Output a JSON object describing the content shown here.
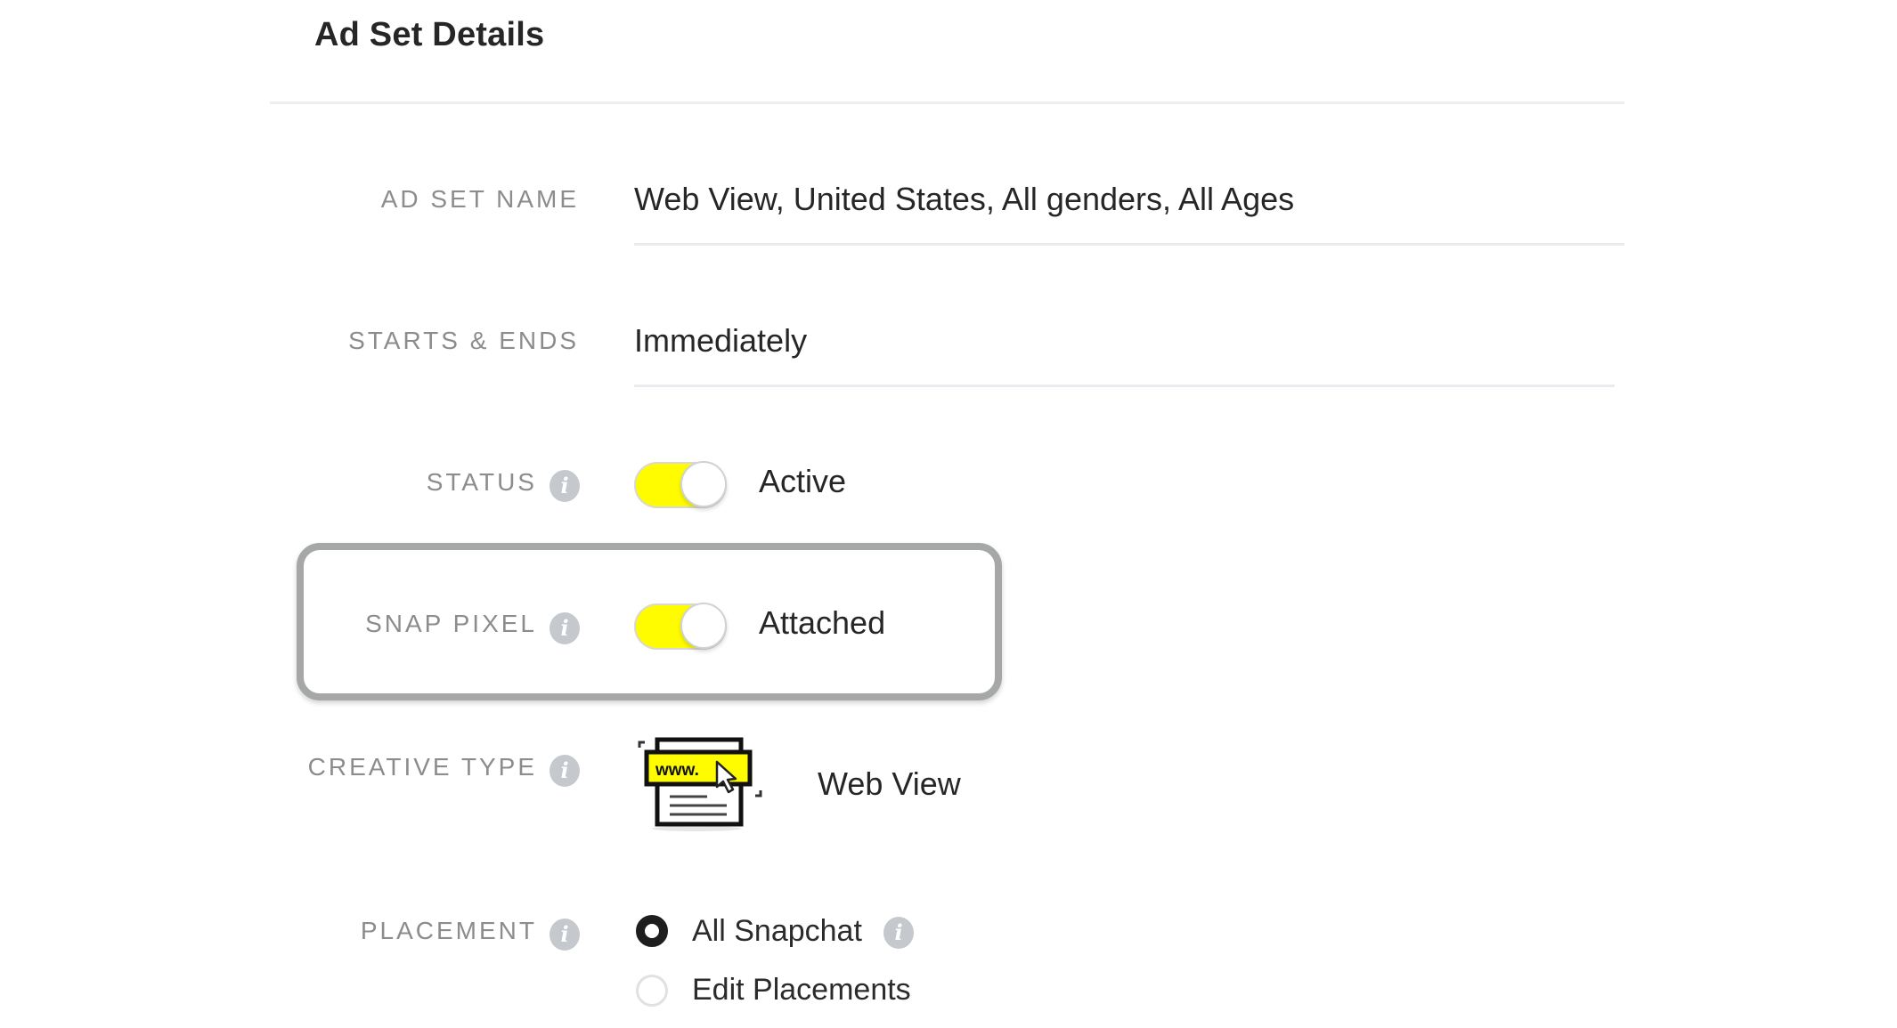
{
  "header": {
    "title": "Ad Set Details"
  },
  "fields": {
    "ad_set_name": {
      "label": "AD SET NAME",
      "value": "Web View, United States, All genders, All Ages"
    },
    "starts_ends": {
      "label": "STARTS & ENDS",
      "value": "Immediately"
    },
    "status": {
      "label": "STATUS",
      "info_icon": "info-icon",
      "toggle_on": true,
      "value": "Active"
    },
    "snap_pixel": {
      "label": "SNAP PIXEL",
      "info_icon": "info-icon",
      "toggle_on": true,
      "value": "Attached",
      "highlighted": true
    },
    "creative_type": {
      "label": "CREATIVE TYPE",
      "info_icon": "info-icon",
      "icon": "web-view-icon",
      "icon_text": "www.",
      "value": "Web View"
    },
    "placement": {
      "label": "PLACEMENT",
      "info_icon": "info-icon",
      "options": [
        {
          "label": "All Snapchat",
          "selected": true,
          "has_info": true
        },
        {
          "label": "Edit Placements",
          "selected": false,
          "has_info": false
        }
      ]
    }
  },
  "colors": {
    "accent_yellow": "#fffc00",
    "label_gray": "#8c8c8c",
    "highlight_border": "#a6a7a7"
  },
  "info_glyph": "i"
}
